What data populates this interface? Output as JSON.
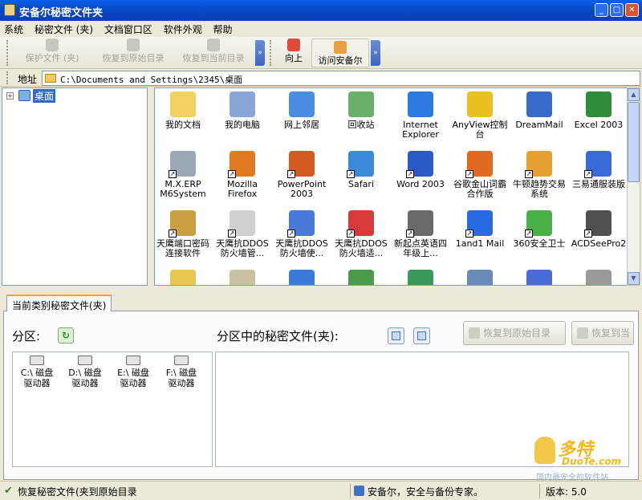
{
  "window": {
    "title": "安备尔秘密文件夹"
  },
  "menu": [
    "系统",
    "秘密文件 (夹)",
    "文档窗口区",
    "软件外观",
    "帮助"
  ],
  "toolbar": {
    "protect": "保护文件 (夹)",
    "restore_original": "恢复到原始目录",
    "restore_current": "恢复到当前目录",
    "up": "向上",
    "visit": "访问安备尔"
  },
  "address": {
    "label": "地址",
    "path": "C:\\Documents and Settings\\2345\\桌面"
  },
  "tree": {
    "root": "桌面"
  },
  "icons": [
    {
      "label": "我的文档",
      "icon": "my-documents-icon",
      "color": "#f0d060"
    },
    {
      "label": "我的电脑",
      "icon": "my-computer-icon",
      "color": "#8aa6d8"
    },
    {
      "label": "网上邻居",
      "icon": "network-icon",
      "color": "#4a8ee0"
    },
    {
      "label": "回收站",
      "icon": "recycle-bin-icon",
      "color": "#6ab06a"
    },
    {
      "label": "Internet Explorer",
      "icon": "ie-icon",
      "color": "#2a7ae0"
    },
    {
      "label": "AnyView控制台",
      "icon": "anyview-icon",
      "color": "#e8c020"
    },
    {
      "label": "DreamMail",
      "icon": "dreammail-icon",
      "color": "#3a6ac8"
    },
    {
      "label": "Excel 2003",
      "icon": "excel-icon",
      "color": "#2e8b3a"
    },
    {
      "label": "M.X.ERP M6System",
      "icon": "erp-icon",
      "color": "#9aa8b8"
    },
    {
      "label": "Mozilla Firefox",
      "icon": "firefox-icon",
      "color": "#e07a20"
    },
    {
      "label": "PowerPoint 2003",
      "icon": "powerpoint-icon",
      "color": "#d05a20"
    },
    {
      "label": "Safari",
      "icon": "safari-icon",
      "color": "#3a8ad8"
    },
    {
      "label": "Word 2003",
      "icon": "word-icon",
      "color": "#2a5ac8"
    },
    {
      "label": "谷歌金山词霸合作版",
      "icon": "ciba-icon",
      "color": "#e06a20"
    },
    {
      "label": "牛顿趋势交易系统",
      "icon": "trade-icon",
      "color": "#e8a030"
    },
    {
      "label": "三易通服装版",
      "icon": "clothing-icon",
      "color": "#3a6ad8"
    },
    {
      "label": "天鹰端口密码连接软件",
      "icon": "keys-icon",
      "color": "#c8a040"
    },
    {
      "label": "天鹰抗DDOS防火墙管...",
      "icon": "eagle-icon",
      "color": "#d0d0d0"
    },
    {
      "label": "天鹰抗DDOS防火墙使...",
      "icon": "doc-icon",
      "color": "#4a7ad8"
    },
    {
      "label": "天鹰抗DDOS防火墙适...",
      "icon": "firewall-icon",
      "color": "#d83a3a"
    },
    {
      "label": "新起点英语四年级上...",
      "icon": "speaker-icon",
      "color": "#6a6a6a"
    },
    {
      "label": "1and1 Mail",
      "icon": "mail-icon",
      "color": "#2a6ae0"
    },
    {
      "label": "360安全卫士",
      "icon": "shield-icon",
      "color": "#4ab04a"
    },
    {
      "label": "ACDSeePro2",
      "icon": "camera-icon",
      "color": "#505050"
    },
    {
      "label": "",
      "icon": "app-icon",
      "color": "#e8c850"
    },
    {
      "label": "",
      "icon": "pencil-icon",
      "color": "#c8c0a0"
    },
    {
      "label": "",
      "icon": "help-icon",
      "color": "#3a7ad8"
    },
    {
      "label": "",
      "icon": "tool-icon",
      "color": "#4a9a4a"
    },
    {
      "label": "",
      "icon": "globe-icon",
      "color": "#3a9a5a"
    },
    {
      "label": "",
      "icon": "image-icon",
      "color": "#6a8ab8"
    },
    {
      "label": "",
      "icon": "window-icon",
      "color": "#4a6ad8"
    },
    {
      "label": "",
      "icon": "mac-icon",
      "color": "#9a9a9a"
    }
  ],
  "lower": {
    "tab": "当前类别秘密文件(夹)",
    "partition_label": "分区:",
    "secret_label": "分区中的秘密文件(夹):",
    "btn_restore_original": "恢复到原始目录",
    "btn_restore_current": "恢复到当"
  },
  "drives": [
    {
      "letter": "C:\\",
      "line1": "磁盘",
      "line2": "驱动器"
    },
    {
      "letter": "D:\\",
      "line1": "磁盘",
      "line2": "驱动器"
    },
    {
      "letter": "E:\\",
      "line1": "磁盘",
      "line2": "驱动器"
    },
    {
      "letter": "F:\\",
      "line1": "磁盘",
      "line2": "驱动器"
    }
  ],
  "status": {
    "left": "恢复秘密文件(夹到原始目录",
    "middle": "安备尔，安全与备份专家。",
    "version": "版本: 5.0"
  },
  "watermark": {
    "a": "多特",
    "b": "DuoTe.com",
    "c": "国内最安全的软件站"
  }
}
